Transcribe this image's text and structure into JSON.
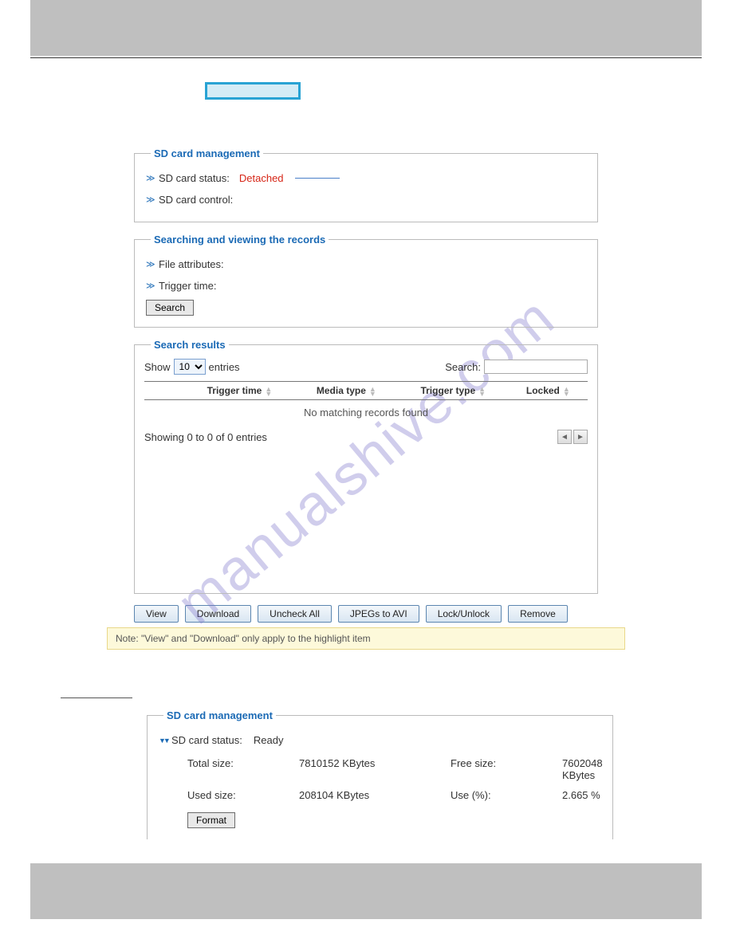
{
  "watermark": "manualshive.com",
  "section1": {
    "legend": "SD card management",
    "status_label": "SD card status:",
    "status_value": "Detached",
    "control_label": "SD card control:"
  },
  "section2": {
    "legend": "Searching and viewing the records",
    "file_attr": "File attributes:",
    "trigger_time": "Trigger time:",
    "search_btn": "Search"
  },
  "section3": {
    "legend": "Search results",
    "show_prefix": "Show",
    "show_suffix": "entries",
    "entries_value": "10",
    "search_label": "Search:",
    "headers": {
      "empty": "",
      "trigger_time": "Trigger time",
      "media_type": "Media type",
      "trigger_type": "Trigger type",
      "locked": "Locked"
    },
    "no_match": "No matching records found",
    "showing": "Showing 0 to 0 of 0 entries"
  },
  "buttons": {
    "view": "View",
    "download": "Download",
    "uncheck": "Uncheck All",
    "jpegs": "JPEGs to AVI",
    "lock": "Lock/Unlock",
    "remove": "Remove"
  },
  "note": "Note: \"View\" and \"Download\" only apply to the highlight item",
  "section4": {
    "legend": "SD card management",
    "status_label": "SD card status:",
    "status_value": "Ready",
    "total_size_lbl": "Total size:",
    "total_size_val": "7810152  KBytes",
    "free_size_lbl": "Free size:",
    "free_size_val": "7602048  KBytes",
    "used_size_lbl": "Used size:",
    "used_size_val": "208104  KBytes",
    "use_pct_lbl": "Use (%):",
    "use_pct_val": "2.665 %",
    "format_btn": "Format"
  }
}
